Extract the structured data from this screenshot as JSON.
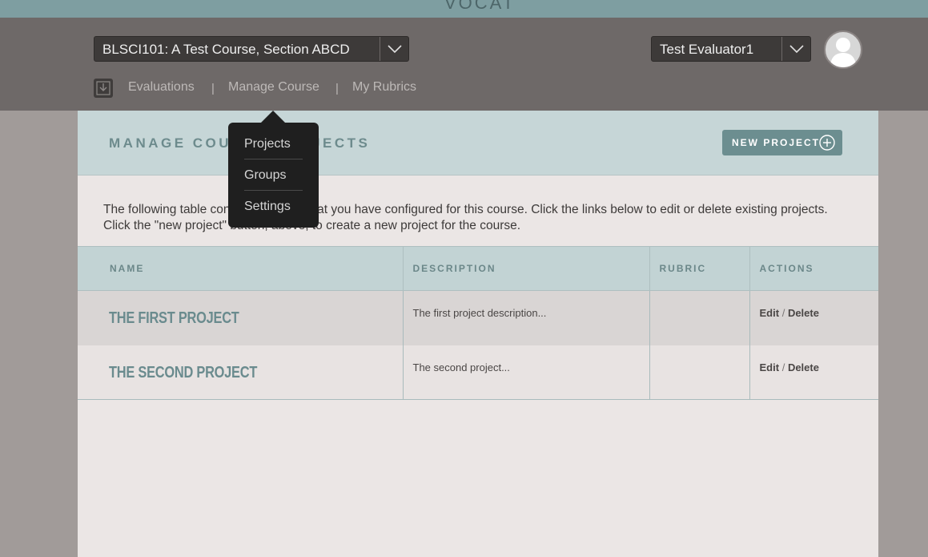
{
  "app": {
    "logo": "VOCAT"
  },
  "header": {
    "course_select": "BLSCI101: A Test Course, Section ABCD",
    "user_select": "Test Evaluator1",
    "nav": {
      "evaluations": "Evaluations",
      "separator": "|",
      "manage_course": "Manage Course",
      "my_rubrics": "My Rubrics"
    }
  },
  "dropdown": {
    "items": [
      "Projects",
      "Groups",
      "Settings"
    ]
  },
  "main": {
    "title": "MANAGE COURSE PROJECTS",
    "new_project_label": "NEW PROJECT",
    "intro": "The following table contains projects that you have configured for this course. Click the links below to edit or delete existing projects. Click the \"new project\" button, above, to create a new project for the course.",
    "table": {
      "columns": [
        "NAME",
        "DESCRIPTION",
        "RUBRIC",
        "ACTIONS"
      ],
      "rows": [
        {
          "name": "THE FIRST PROJECT",
          "description": "The first project description...",
          "rubric": "",
          "edit": "Edit",
          "slash": "/",
          "delete": "Delete"
        },
        {
          "name": "THE SECOND PROJECT",
          "description": "The second project...",
          "rubric": "",
          "edit": "Edit",
          "slash": "/",
          "delete": "Delete"
        }
      ]
    }
  },
  "colors": {
    "accent": "#6c8e90",
    "header_bg": "#6e6968",
    "panel_header_bg": "#c6d6d7",
    "dropdown_bg": "#1f1f1f"
  }
}
